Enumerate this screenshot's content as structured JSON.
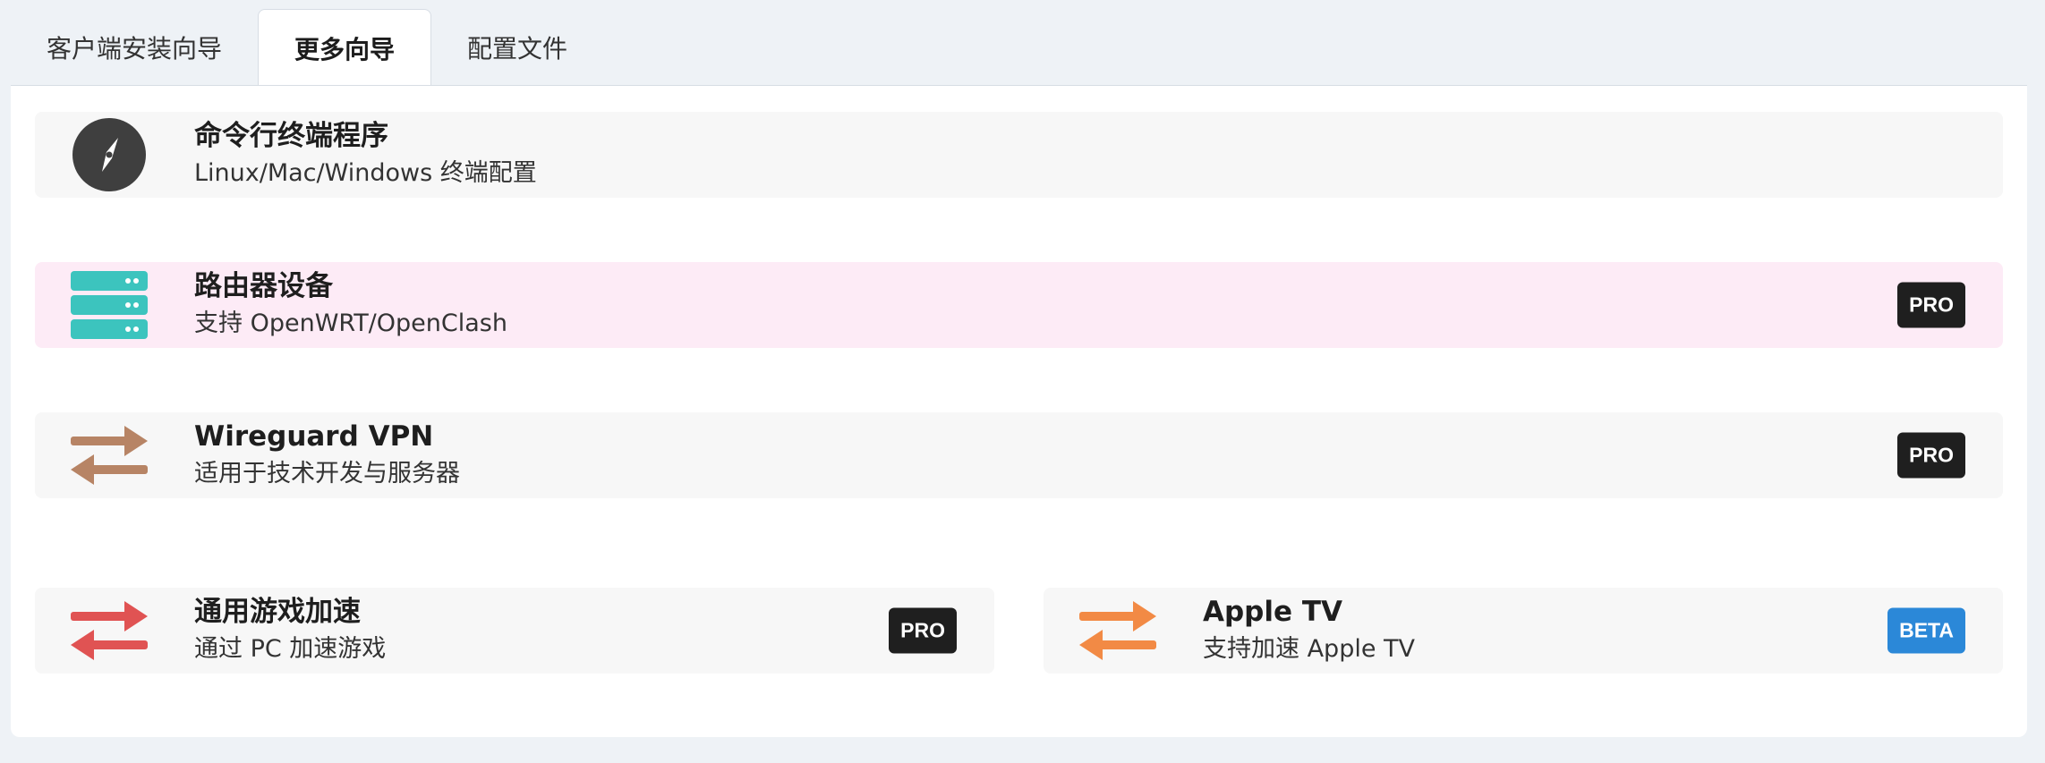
{
  "tabs": [
    {
      "label": "客户端安装向导",
      "active": false
    },
    {
      "label": "更多向导",
      "active": true
    },
    {
      "label": "配置文件",
      "active": false
    }
  ],
  "cards": {
    "cli": {
      "title": "命令行终端程序",
      "subtitle": "Linux/Mac/Windows 终端配置",
      "icon": "compass-icon"
    },
    "router": {
      "title": "路由器设备",
      "subtitle": "支持 OpenWRT/OpenClash",
      "icon": "server-icon",
      "badge": "PRO"
    },
    "wireguard": {
      "title": "Wireguard VPN",
      "subtitle": "适用于技术开发与服务器",
      "icon": "swap-arrows-icon",
      "badge": "PRO"
    },
    "game": {
      "title": "通用游戏加速",
      "subtitle": "通过 PC 加速游戏",
      "icon": "swap-arrows-icon",
      "badge": "PRO"
    },
    "appletv": {
      "title": "Apple TV",
      "subtitle": "支持加速 Apple TV",
      "icon": "swap-arrows-icon",
      "badge": "BETA"
    }
  },
  "colors": {
    "compass": "#3f3f3f",
    "server": "#3cc4be",
    "wireguard_arrows": "#b78465",
    "game_arrows": "#e05353",
    "appletv_arrows": "#f28a45",
    "pro_badge": "#1f1f1f",
    "beta_badge": "#2b88d8",
    "router_bg": "#fdebf6"
  }
}
